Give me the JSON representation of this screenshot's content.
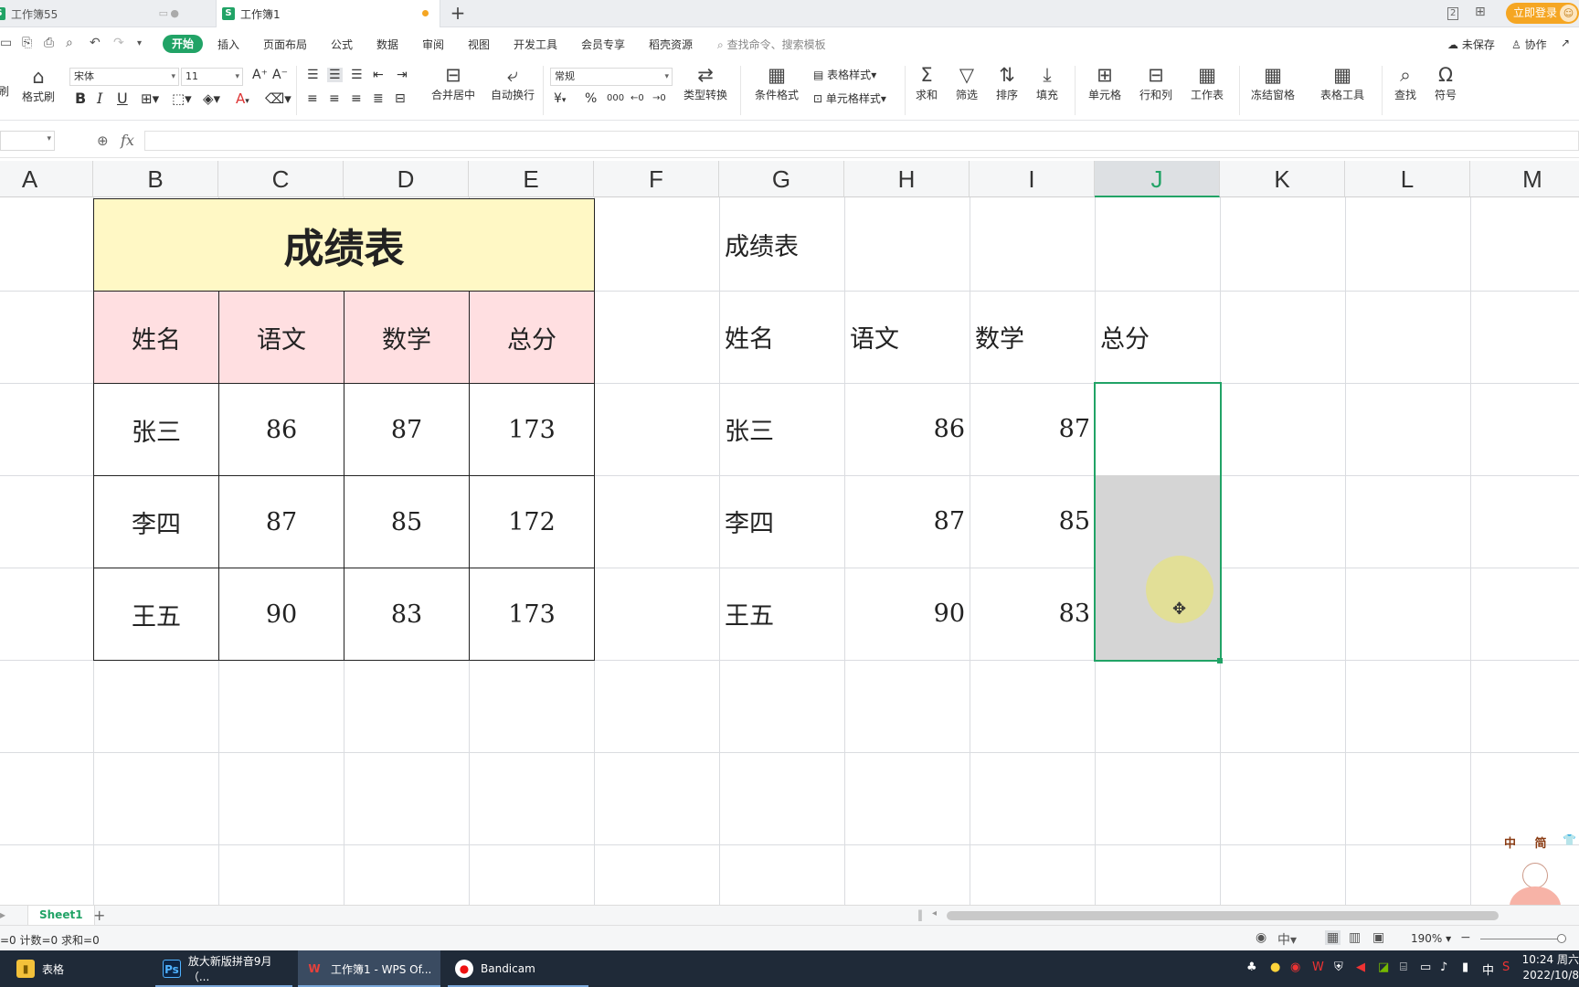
{
  "tabs": {
    "inactive_title": "工作簿55",
    "active_title": "工作簿1",
    "new_tab_symbol": "+",
    "login_button": "立即登录",
    "window_badge": "2"
  },
  "menu": {
    "items": [
      "开始",
      "插入",
      "页面布局",
      "公式",
      "数据",
      "审阅",
      "视图",
      "开发工具",
      "会员专享",
      "稻壳资源"
    ],
    "search_placeholder": "查找命令、搜索模板",
    "unsaved": "未保存",
    "collab": "协作"
  },
  "ribbon": {
    "format_painter": "格式刷",
    "paste_partial": "刷",
    "font_name": "宋体",
    "font_size": "11",
    "merge_center": "合并居中",
    "auto_wrap": "自动换行",
    "number_format": "常规",
    "type_convert": "类型转换",
    "conditional_format": "条件格式",
    "table_style": "表格样式",
    "cell_style": "单元格样式",
    "sum": "求和",
    "filter": "筛选",
    "sort": "排序",
    "fill": "填充",
    "cell": "单元格",
    "row_col": "行和列",
    "worksheet": "工作表",
    "freeze": "冻结窗格",
    "table_tools": "表格工具",
    "find": "查找",
    "symbol": "符号",
    "currency_symbol": "¥",
    "percent_symbol": "%",
    "thousands_symbol": "000"
  },
  "formula_bar": {
    "fx_label": "fx",
    "value": ""
  },
  "grid": {
    "columns": [
      "A",
      "B",
      "C",
      "D",
      "E",
      "F",
      "G",
      "H",
      "I",
      "J",
      "K",
      "L",
      "M"
    ],
    "selected_column": "J",
    "left_table": {
      "title": "成绩表",
      "headers": [
        "姓名",
        "语文",
        "数学",
        "总分"
      ],
      "rows": [
        [
          "张三",
          "86",
          "87",
          "173"
        ],
        [
          "李四",
          "87",
          "85",
          "172"
        ],
        [
          "王五",
          "90",
          "83",
          "173"
        ]
      ]
    },
    "right_table": {
      "title": "成绩表",
      "headers": [
        "姓名",
        "语文",
        "数学",
        "总分"
      ],
      "rows": [
        [
          "张三",
          "86",
          "87",
          ""
        ],
        [
          "李四",
          "87",
          "85",
          ""
        ],
        [
          "王五",
          "90",
          "83",
          ""
        ]
      ]
    }
  },
  "sheets": {
    "tabs": [
      "Sheet1"
    ],
    "add_symbol": "+"
  },
  "status": {
    "text": "=0 计数=0 求和=0",
    "zoom": "190%"
  },
  "taskbar": {
    "items": [
      "表格",
      "放大新版拼音9月（...",
      "工作簿1 - WPS Of...",
      "Bandicam"
    ],
    "ime": "中",
    "time": "10:24 周六",
    "date": "2022/10/8"
  },
  "mascot_text": "中 简",
  "colors": {
    "accent": "#21a366",
    "title_fill": "#fff8c5",
    "header_fill": "#ffdfe1",
    "selection_fill": "#d5d5d5",
    "login_orange": "#f5a623"
  }
}
